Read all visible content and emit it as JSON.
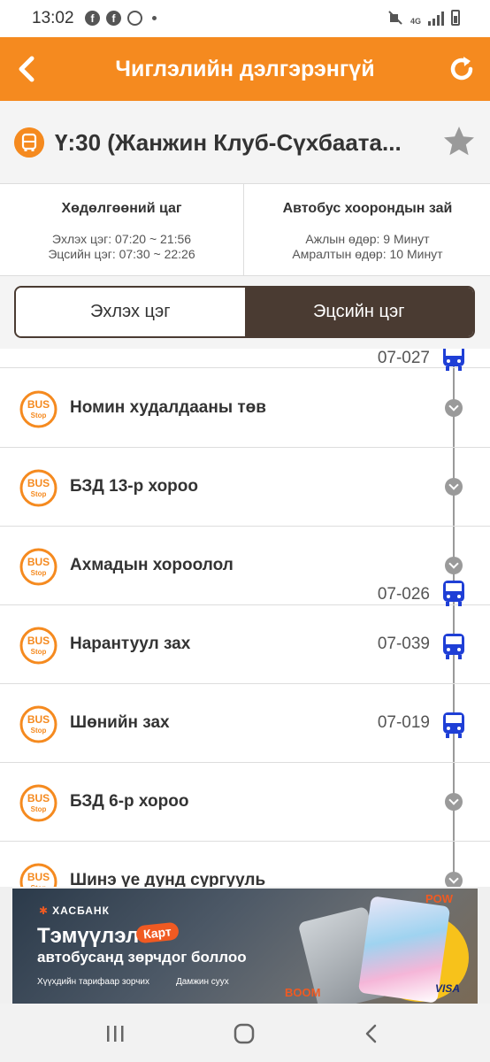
{
  "status_bar": {
    "time": "13:02",
    "network": "4G"
  },
  "header": {
    "title": "Чиглэлийн дэлгэрэнгүй",
    "color": "#f58a1f"
  },
  "route": {
    "name": "Ү:30 (Жанжин Клуб-Сүхбаата..."
  },
  "info": {
    "schedule": {
      "heading": "Хөдөлгөөний цаг",
      "start_line": "Эхлэх цэг: 07:20 ~ 21:56",
      "end_line": "Эцсийн цэг: 07:30 ~ 22:26"
    },
    "interval": {
      "heading": "Автобус хоорондын зай",
      "weekday_line": "Ажлын өдөр: 9 Минут",
      "weekend_line": "Амралтын өдөр: 10 Минут"
    }
  },
  "segment": {
    "start_label": "Эхлэх цэг",
    "end_label": "Эцсийн цэг",
    "selected": "Эхлэх цэг"
  },
  "stops": {
    "top_bus": "07-027",
    "items": [
      {
        "name": "Номин худалдааны төв",
        "bus_code": ""
      },
      {
        "name": "БЗД 13-р хороо",
        "bus_code": ""
      },
      {
        "name": "Ахмадын хороолол",
        "bus_code": "07-026"
      },
      {
        "name": "Нарантуул зах",
        "bus_code": "07-039"
      },
      {
        "name": "Шөнийн зах",
        "bus_code": "07-019"
      },
      {
        "name": "БЗД 6-р хороо",
        "bus_code": ""
      },
      {
        "name": "Шинэ үе дунд сургууль",
        "bus_code": ""
      }
    ],
    "stop_icon_text_top": "BUS",
    "stop_icon_text_bottom": "Stop"
  },
  "banner": {
    "bank": "ХАСБАНК",
    "line1": "Тэмүүлэл",
    "kart": "Карт",
    "line2": "автобусанд зөрчдог боллоо",
    "bullet1": "Хүүхдийн тарифаар зорчих",
    "bullet2": "Дамжин суух",
    "pow": "POW",
    "boom": "BOOM",
    "visa": "VISA"
  }
}
